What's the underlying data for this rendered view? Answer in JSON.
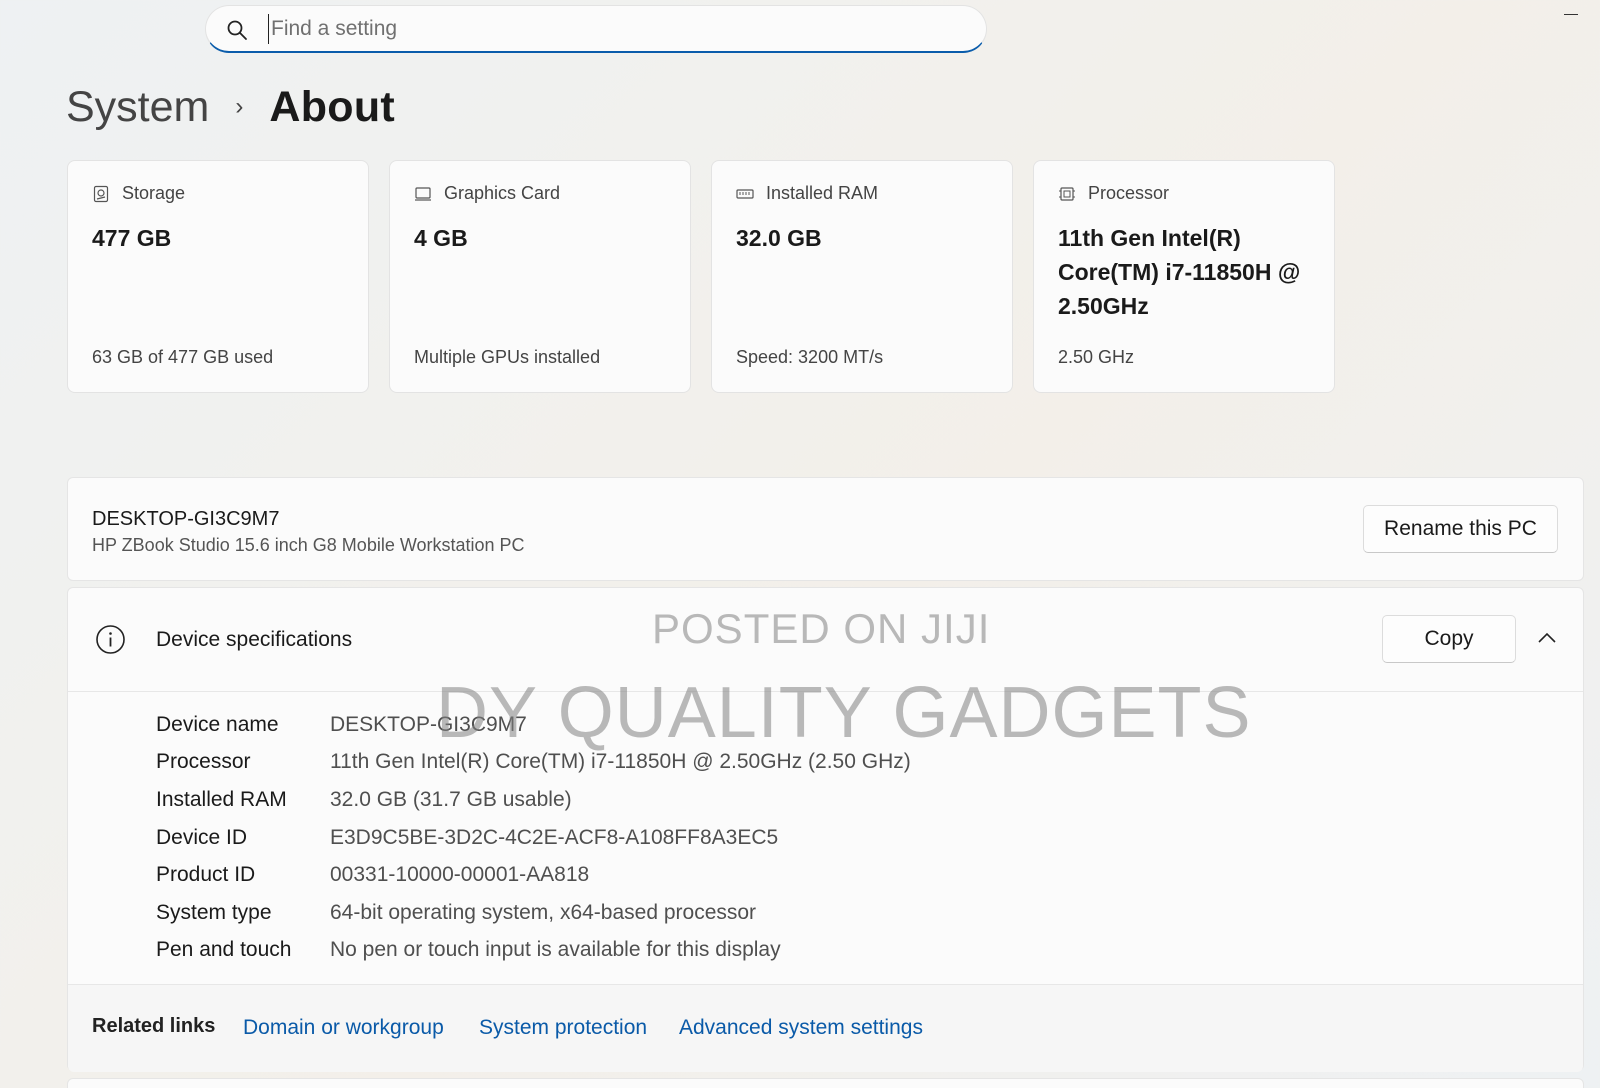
{
  "search": {
    "placeholder": "Find a setting"
  },
  "breadcrumb": {
    "parent": "System",
    "separator": "›",
    "current": "About"
  },
  "cards": [
    {
      "icon": "storage-icon",
      "label": "Storage",
      "value": "477 GB",
      "sub": "63 GB of 477 GB used"
    },
    {
      "icon": "graphics-card-icon",
      "label": "Graphics Card",
      "value": "4 GB",
      "sub": "Multiple GPUs installed"
    },
    {
      "icon": "ram-icon",
      "label": "Installed RAM",
      "value": "32.0 GB",
      "sub": "Speed: 3200 MT/s"
    },
    {
      "icon": "processor-icon",
      "label": "Processor",
      "value": "11th Gen Intel(R) Core(TM) i7-11850H @ 2.50GHz",
      "sub": "2.50 GHz"
    }
  ],
  "pc": {
    "name": "DESKTOP-GI3C9M7",
    "model": "HP ZBook Studio 15.6 inch G8 Mobile Workstation PC",
    "rename_label": "Rename this PC"
  },
  "specs": {
    "title": "Device specifications",
    "copy_label": "Copy",
    "rows": [
      {
        "label": "Device name",
        "value": "DESKTOP-GI3C9M7"
      },
      {
        "label": "Processor",
        "value": "11th Gen Intel(R) Core(TM) i7-11850H @ 2.50GHz (2.50 GHz)"
      },
      {
        "label": "Installed RAM",
        "value": "32.0 GB (31.7 GB usable)"
      },
      {
        "label": "Device ID",
        "value": "E3D9C5BE-3D2C-4C2E-ACF8-A108FF8A3EC5"
      },
      {
        "label": "Product ID",
        "value": "00331-10000-00001-AA818"
      },
      {
        "label": "System type",
        "value": "64-bit operating system, x64-based processor"
      },
      {
        "label": "Pen and touch",
        "value": "No pen or touch input is available for this display"
      }
    ]
  },
  "related": {
    "label": "Related links",
    "links": [
      "Domain or workgroup",
      "System protection",
      "Advanced system settings"
    ]
  },
  "watermark": {
    "line1": "POSTED ON JIJI",
    "line2": "DY QUALITY GADGETS"
  },
  "colors": {
    "accent": "#0a5cab",
    "link": "#0a5aa8"
  }
}
